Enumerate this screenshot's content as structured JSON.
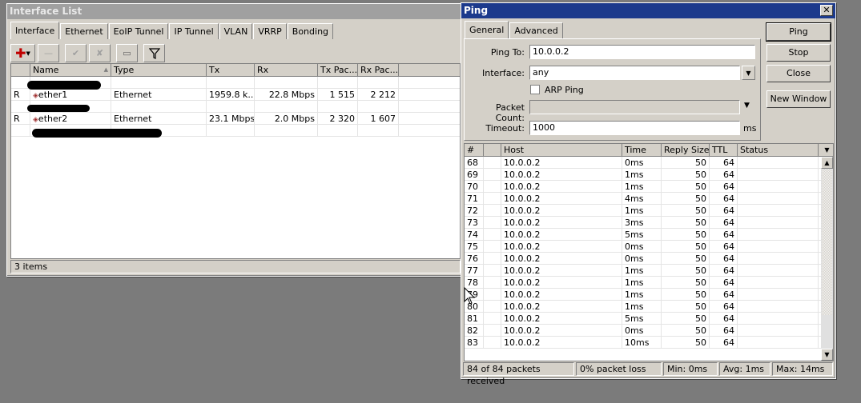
{
  "interface_list": {
    "title": "Interface List",
    "tabs": [
      "Interface",
      "Ethernet",
      "EoIP Tunnel",
      "IP Tunnel",
      "VLAN",
      "VRRP",
      "Bonding"
    ],
    "columns": [
      "Name",
      "Type",
      "Tx",
      "Rx",
      "Tx Pac...",
      "Rx Pac..."
    ],
    "rows": [
      {
        "flag": "R",
        "name": "ether1",
        "type": "Ethernet",
        "tx": "1959.8 k...",
        "rx": "22.8 Mbps",
        "tx_pac": "1 515",
        "rx_pac": "2 212"
      },
      {
        "flag": "R",
        "name": "ether2",
        "type": "Ethernet",
        "tx": "23.1 Mbps",
        "rx": "2.0 Mbps",
        "tx_pac": "2 320",
        "rx_pac": "1 607"
      }
    ],
    "status": "3 items"
  },
  "ping": {
    "title": "Ping",
    "tabs": [
      "General",
      "Advanced"
    ],
    "ping_to_label": "Ping To:",
    "ping_to_value": "10.0.0.2",
    "interface_label": "Interface:",
    "interface_value": "any",
    "arp_ping_label": "ARP Ping",
    "packet_count_label": "Packet Count:",
    "timeout_label": "Timeout:",
    "timeout_value": "1000",
    "timeout_unit": "ms",
    "buttons": {
      "ping": "Ping",
      "stop": "Stop",
      "close": "Close",
      "new_window": "New Window"
    },
    "columns": [
      "#",
      "Host",
      "Time",
      "Reply Size",
      "TTL",
      "Status"
    ],
    "rows": [
      [
        "68",
        "10.0.0.2",
        "0ms",
        "50",
        "64"
      ],
      [
        "69",
        "10.0.0.2",
        "1ms",
        "50",
        "64"
      ],
      [
        "70",
        "10.0.0.2",
        "1ms",
        "50",
        "64"
      ],
      [
        "71",
        "10.0.0.2",
        "4ms",
        "50",
        "64"
      ],
      [
        "72",
        "10.0.0.2",
        "1ms",
        "50",
        "64"
      ],
      [
        "73",
        "10.0.0.2",
        "3ms",
        "50",
        "64"
      ],
      [
        "74",
        "10.0.0.2",
        "5ms",
        "50",
        "64"
      ],
      [
        "75",
        "10.0.0.2",
        "0ms",
        "50",
        "64"
      ],
      [
        "76",
        "10.0.0.2",
        "0ms",
        "50",
        "64"
      ],
      [
        "77",
        "10.0.0.2",
        "1ms",
        "50",
        "64"
      ],
      [
        "78",
        "10.0.0.2",
        "1ms",
        "50",
        "64"
      ],
      [
        "79",
        "10.0.0.2",
        "1ms",
        "50",
        "64"
      ],
      [
        "80",
        "10.0.0.2",
        "1ms",
        "50",
        "64"
      ],
      [
        "81",
        "10.0.0.2",
        "5ms",
        "50",
        "64"
      ],
      [
        "82",
        "10.0.0.2",
        "0ms",
        "50",
        "64"
      ],
      [
        "83",
        "10.0.0.2",
        "10ms",
        "50",
        "64"
      ]
    ],
    "status": {
      "received": "84 of 84 packets received",
      "loss": "0% packet loss",
      "min": "Min: 0ms",
      "avg": "Avg: 1ms",
      "max": "Max: 14ms"
    }
  }
}
